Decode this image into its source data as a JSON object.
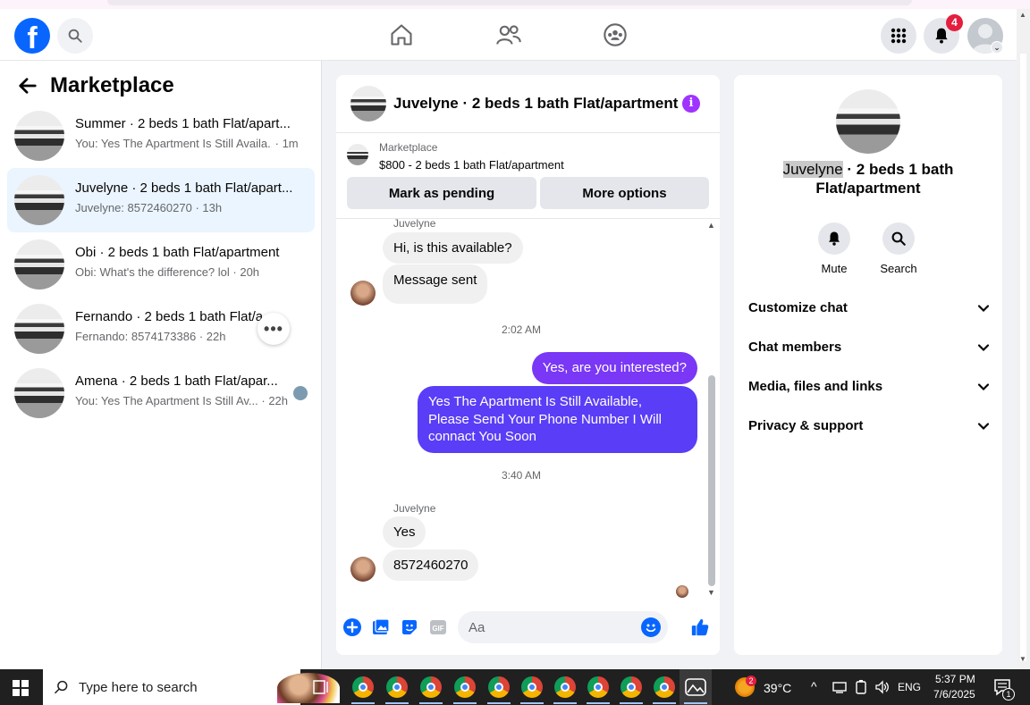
{
  "header": {
    "logo_letter": "f",
    "notifications_count": "4"
  },
  "sidebar": {
    "title": "Marketplace",
    "conversations": [
      {
        "name": "Summer · 2 beds 1 bath Flat/apart...",
        "snippet": "You: Yes The Apartment Is Still Availa...",
        "time": "· 1m"
      },
      {
        "name": "Juvelyne · 2 beds 1 bath Flat/apart...",
        "snippet": "Juvelyne: 8572460270",
        "time": "· 13h"
      },
      {
        "name": "Obi · 2 beds 1 bath Flat/apartment",
        "snippet": "Obi: What's the difference? lol",
        "time": "· 20h"
      },
      {
        "name": "Fernando · 2 beds 1 bath Flat/a...",
        "snippet": "Fernando: 8574173386",
        "time": "· 22h"
      },
      {
        "name": "Amena · 2 beds 1 bath Flat/apar...",
        "snippet": "You: Yes The Apartment Is Still Av...",
        "time": "· 22h"
      }
    ],
    "more_label": "•••"
  },
  "chat": {
    "title": "Juvelyne · 2 beds 1 bath Flat/apartment",
    "info_glyph": "i",
    "listing": {
      "label": "Marketplace",
      "price_title": "$800 - 2 beds 1 bath Flat/apartment",
      "mark_pending": "Mark as pending",
      "more_options": "More options"
    },
    "messages": {
      "sender1": "Juvelyne",
      "in1": "Hi, is this available?",
      "in2": "Message sent",
      "ts1": "2:02 AM",
      "out1": "Yes, are you interested?",
      "out2": "Yes The Apartment Is Still Available, Please Send Your Phone Number I Will connact You Soon",
      "ts2": "3:40 AM",
      "sender2": "Juvelyne",
      "in3": "Yes",
      "in4": "8572460270"
    },
    "composer_placeholder": "Aa"
  },
  "info_panel": {
    "name_highlight": "Juvelyne",
    "name_rest": " · 2 beds 1 bath Flat/apartment",
    "mute_label": "Mute",
    "search_label": "Search",
    "sections": [
      "Customize chat",
      "Chat members",
      "Media, files and links",
      "Privacy & support"
    ]
  },
  "taskbar": {
    "search_text": "Type here to search",
    "weather_badge": "2",
    "temperature": "39°C",
    "language": "ENG",
    "time": "5:37 PM",
    "date": "7/6/2025",
    "notif_count": "1"
  },
  "colors": {
    "brand": "#0866ff",
    "outgoing_bubble": "#7a37f5",
    "active_row": "#ebf5ff",
    "badge": "#e41e3f"
  }
}
